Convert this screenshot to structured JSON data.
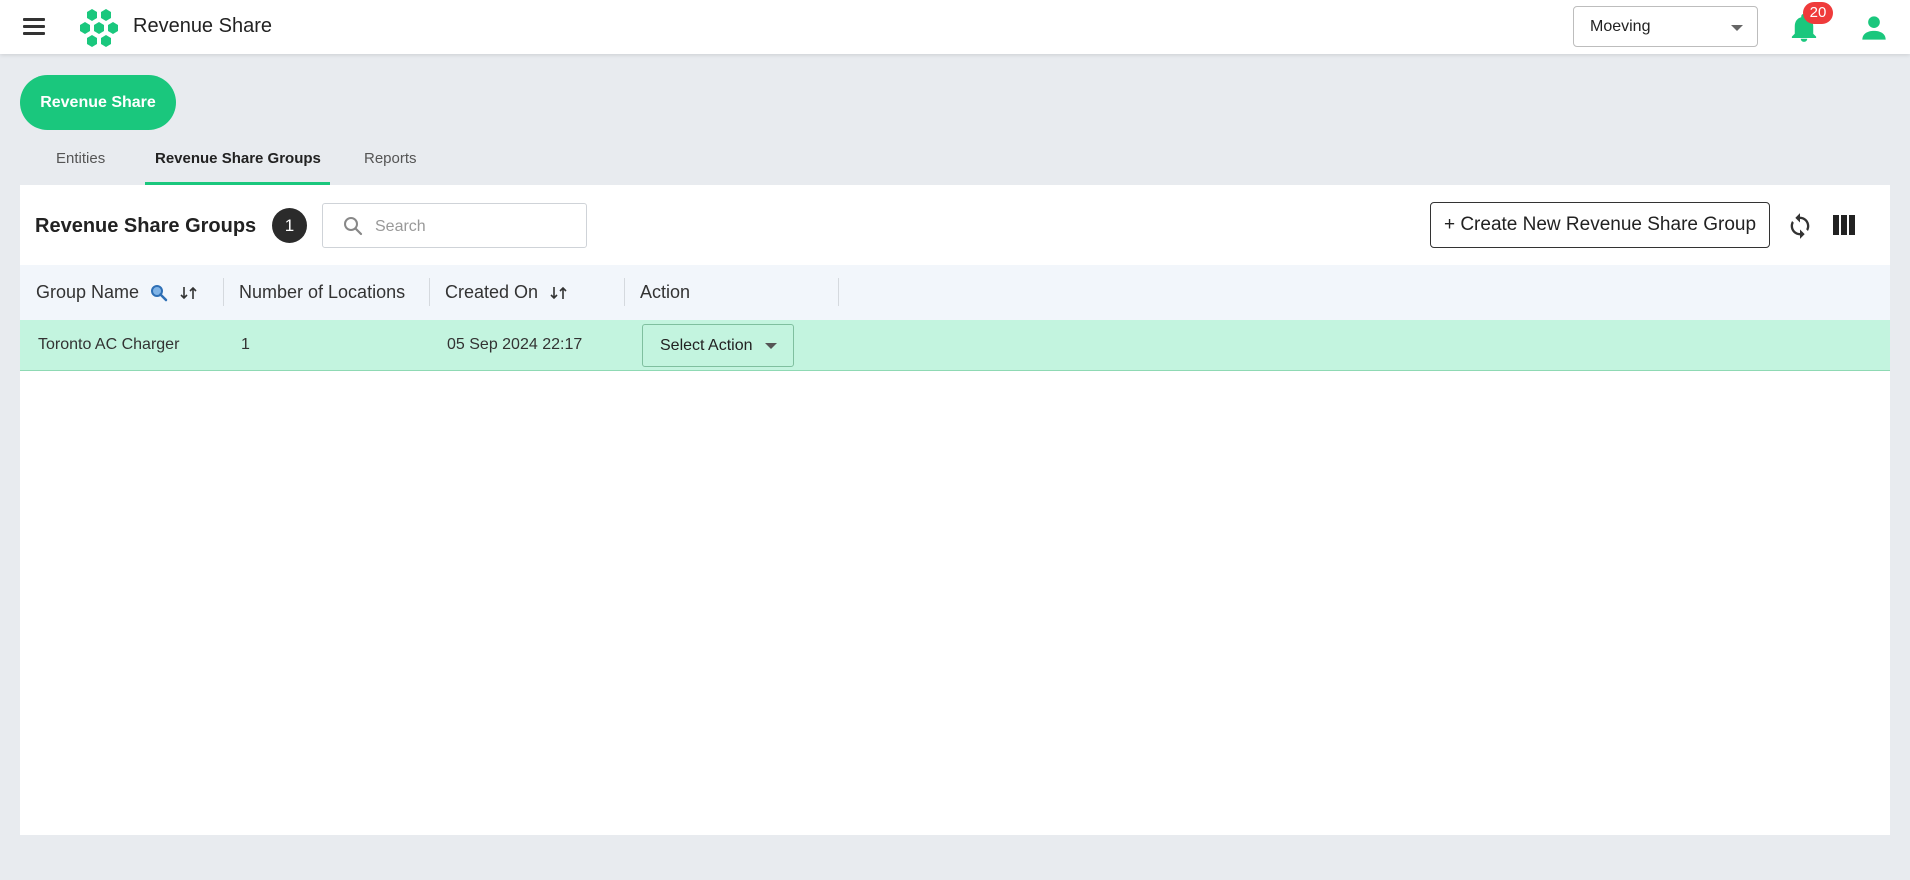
{
  "app": {
    "title": "Revenue Share",
    "org_select": {
      "value": "Moeving"
    },
    "notifications": {
      "count": "20"
    }
  },
  "page": {
    "header_button": "Revenue Share",
    "tabs": [
      {
        "label": "Entities",
        "active": false
      },
      {
        "label": "Revenue Share Groups",
        "active": true
      },
      {
        "label": "Reports",
        "active": false
      }
    ]
  },
  "card": {
    "title": "Revenue Share Groups",
    "count": "1",
    "search": {
      "placeholder": "Search",
      "value": ""
    },
    "create_button": "+ Create New Revenue Share Group"
  },
  "table": {
    "columns": [
      "Group Name",
      "Number of Locations",
      "Created On",
      "Action"
    ],
    "rows": [
      {
        "group_name": "Toronto AC Charger",
        "locations": "1",
        "created_on": "05 Sep 2024 22:17",
        "action": "Select Action"
      }
    ]
  },
  "colors": {
    "accent": "#1ac77d",
    "row_highlight": "#c3f4df",
    "badge_red": "#ef3b3b"
  },
  "icons": [
    "menu-icon",
    "logo-icon",
    "bell-icon",
    "user-icon",
    "search-icon",
    "refresh-icon",
    "columns-icon",
    "sort-icon",
    "filter-search-icon"
  ]
}
